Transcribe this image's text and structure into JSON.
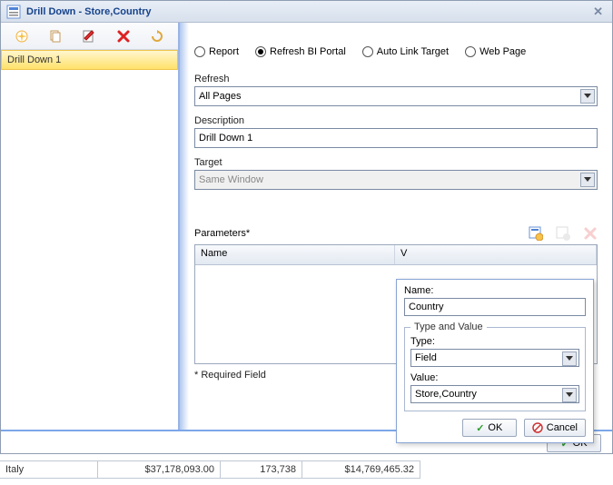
{
  "titlebar": {
    "title": "Drill Down - Store,Country"
  },
  "left": {
    "items": [
      {
        "label": "Drill Down 1"
      }
    ]
  },
  "form": {
    "radios": {
      "report": "Report",
      "refresh_bi": "Refresh BI Portal",
      "auto_link": "Auto Link Target",
      "web_page": "Web Page",
      "selected": "refresh_bi"
    },
    "refresh_label": "Refresh",
    "refresh_value": "All Pages",
    "description_label": "Description",
    "description_value": "Drill Down 1",
    "target_label": "Target",
    "target_value": "Same Window",
    "parameters_label": "Parameters*",
    "required_note": "* Required Field",
    "table": {
      "col_name": "Name",
      "col_value": "V"
    },
    "ok": "OK"
  },
  "popup": {
    "name_label": "Name:",
    "name_value": "Country",
    "fieldset_legend": "Type and Value",
    "type_label": "Type:",
    "type_value": "Field",
    "value_label": "Value:",
    "value_value": "Store,Country",
    "ok": "OK",
    "cancel": "Cancel"
  },
  "background_grid": {
    "c0": "Italy",
    "c1": "$37,178,093.00",
    "c2": "173,738",
    "c3": "$14,769,465.32"
  }
}
